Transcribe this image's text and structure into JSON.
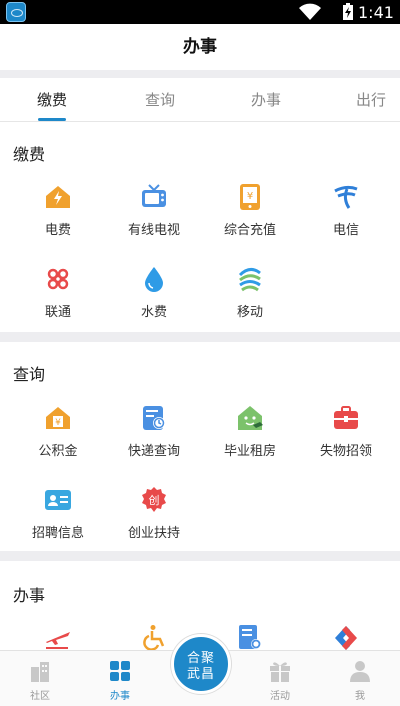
{
  "status_bar": {
    "time": "1:41"
  },
  "header": {
    "title": "办事"
  },
  "tabs": [
    {
      "label": "缴费",
      "active": true
    },
    {
      "label": "查询",
      "active": false
    },
    {
      "label": "办事",
      "active": false
    },
    {
      "label": "出行",
      "active": false
    }
  ],
  "sections": {
    "payment": {
      "title": "缴费",
      "items": [
        {
          "label": "电费",
          "icon": "electricity-icon",
          "color": "#f0a12e"
        },
        {
          "label": "有线电视",
          "icon": "tv-icon",
          "color": "#4a90e2"
        },
        {
          "label": "综合充值",
          "icon": "recharge-icon",
          "color": "#f0a12e"
        },
        {
          "label": "电信",
          "icon": "telecom-icon",
          "color": "#2f7fd8"
        },
        {
          "label": "联通",
          "icon": "unicom-icon",
          "color": "#e84a4a"
        },
        {
          "label": "水费",
          "icon": "water-drop-icon",
          "color": "#2f9be6"
        },
        {
          "label": "移动",
          "icon": "mobile-icon",
          "color": "#2f9be6"
        }
      ]
    },
    "query": {
      "title": "查询",
      "items": [
        {
          "label": "公积金",
          "icon": "housing-fund-icon",
          "color": "#f0a12e"
        },
        {
          "label": "快递查询",
          "icon": "express-icon",
          "color": "#4a90e2"
        },
        {
          "label": "毕业租房",
          "icon": "graduate-house-icon",
          "color": "#7cc26b"
        },
        {
          "label": "失物招领",
          "icon": "lost-found-icon",
          "color": "#e84a4a"
        },
        {
          "label": "招聘信息",
          "icon": "recruit-icon",
          "color": "#39a7e0"
        },
        {
          "label": "创业扶持",
          "icon": "startup-icon",
          "color": "#e84a4a"
        }
      ]
    },
    "affairs": {
      "title": "办事",
      "items": [
        {
          "label": "",
          "icon": "plane-icon",
          "color": "#e84a4a"
        },
        {
          "label": "",
          "icon": "wheelchair-icon",
          "color": "#f0a12e"
        },
        {
          "label": "",
          "icon": "document-search-icon",
          "color": "#4a90e2"
        },
        {
          "label": "",
          "icon": "arrows-icon",
          "color": "#e84a4a"
        }
      ]
    }
  },
  "bottom_nav": {
    "items": [
      {
        "label": "社区",
        "icon": "community-icon",
        "active": false
      },
      {
        "label": "办事",
        "icon": "grid-icon",
        "active": true
      },
      {
        "label": "活动",
        "icon": "gift-icon",
        "active": false
      },
      {
        "label": "我",
        "icon": "user-icon",
        "active": false
      }
    ],
    "center_logo": {
      "line1": "合聚",
      "line2": "武昌"
    }
  },
  "colors": {
    "accent": "#1e88c9",
    "divider": "#ededf0"
  }
}
